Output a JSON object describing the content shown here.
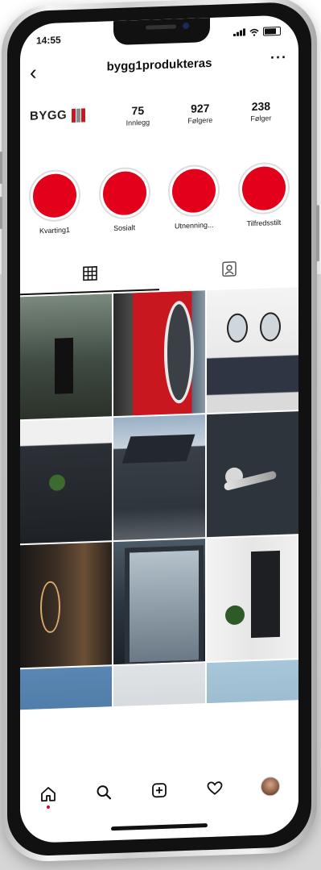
{
  "status_bar": {
    "time": "14:55"
  },
  "header": {
    "back_icon": "chevron-left-icon",
    "username": "bygg1produkteras",
    "more": "···"
  },
  "profile": {
    "logo_text": "BYGG",
    "logo_colors": [
      "#c8171e",
      "#8a8a8a",
      "#c8171e"
    ],
    "stats": [
      {
        "value": "75",
        "label": "Innlegg"
      },
      {
        "value": "927",
        "label": "Følgere"
      },
      {
        "value": "238",
        "label": "Følger"
      }
    ]
  },
  "highlights": [
    {
      "label": "Kvarting1",
      "color": "#e2001a"
    },
    {
      "label": "Sosialt",
      "color": "#e2001a"
    },
    {
      "label": "Utnenning...",
      "color": "#e2001a"
    },
    {
      "label": "Tilfredsstilt",
      "color": "#e2001a"
    }
  ],
  "tabs": [
    {
      "icon": "grid-icon",
      "active": true
    },
    {
      "icon": "tagged-icon",
      "active": false
    }
  ],
  "posts_count_visible": 12,
  "bottom_nav": [
    {
      "icon": "home-icon",
      "active": true
    },
    {
      "icon": "search-icon",
      "active": false
    },
    {
      "icon": "add-post-icon",
      "active": false
    },
    {
      "icon": "heart-icon",
      "active": false
    },
    {
      "icon": "profile-avatar-icon",
      "active": false
    }
  ],
  "colors": {
    "accent": "#e2001a",
    "text": "#111111",
    "background": "#ffffff"
  }
}
